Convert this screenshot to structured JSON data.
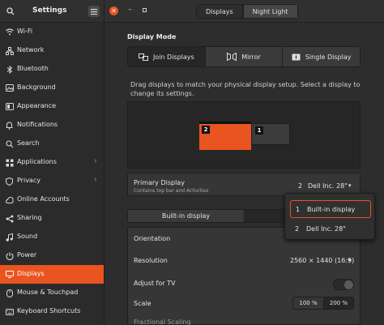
{
  "sidebar": {
    "title": "Settings",
    "items": [
      {
        "label": "Wi-Fi",
        "icon": "wifi-icon",
        "chevron": false
      },
      {
        "label": "Network",
        "icon": "network-icon",
        "chevron": false
      },
      {
        "label": "Bluetooth",
        "icon": "bluetooth-icon",
        "chevron": false
      },
      {
        "label": "Background",
        "icon": "background-icon",
        "chevron": false
      },
      {
        "label": "Appearance",
        "icon": "appearance-icon",
        "chevron": false
      },
      {
        "label": "Notifications",
        "icon": "bell-icon",
        "chevron": false
      },
      {
        "label": "Search",
        "icon": "search-icon",
        "chevron": false
      },
      {
        "label": "Applications",
        "icon": "applications-icon",
        "chevron": true
      },
      {
        "label": "Privacy",
        "icon": "privacy-icon",
        "chevron": true
      },
      {
        "label": "Online Accounts",
        "icon": "online-accounts-icon",
        "chevron": false
      },
      {
        "label": "Sharing",
        "icon": "sharing-icon",
        "chevron": false
      },
      {
        "label": "Sound",
        "icon": "sound-icon",
        "chevron": false
      },
      {
        "label": "Power",
        "icon": "power-icon",
        "chevron": false
      },
      {
        "label": "Displays",
        "icon": "display-icon",
        "chevron": false,
        "active": true
      },
      {
        "label": "Mouse & Touchpad",
        "icon": "mouse-icon",
        "chevron": false
      },
      {
        "label": "Keyboard Shortcuts",
        "icon": "keyboard-icon",
        "chevron": false
      }
    ]
  },
  "header": {
    "tabs": [
      {
        "label": "Displays",
        "active": false
      },
      {
        "label": "Night Light",
        "active": true
      }
    ]
  },
  "display_mode": {
    "title": "Display Mode",
    "options": [
      {
        "label": "Join Displays",
        "active": true
      },
      {
        "label": "Mirror",
        "active": false
      },
      {
        "label": "Single Display",
        "active": false
      }
    ]
  },
  "arrangement": {
    "hint": "Drag displays to match your physical display setup. Select a display to change its settings.",
    "display_1_number": "2",
    "display_2_number": "1"
  },
  "primary_display": {
    "label": "Primary Display",
    "sublabel": "Contains top bar and Activities",
    "value_num": "2",
    "value_name": "Dell Inc. 28\""
  },
  "display_tabs": {
    "first": "Built-in display",
    "second": ""
  },
  "settings": {
    "orientation_label": "Orientation",
    "resolution_label": "Resolution",
    "resolution_value": "2560 × 1440 (16:9)",
    "adjust_tv_label": "Adjust for TV",
    "scale_label": "Scale",
    "scale_options": [
      "100 %",
      "200 %"
    ],
    "scale_selected": "200 %",
    "fractional_label": "Fractional Scaling"
  },
  "dropdown": {
    "items": [
      {
        "num": "1",
        "label": "Built-in display",
        "selected": true
      },
      {
        "num": "2",
        "label": "Dell Inc. 28\"",
        "selected": false
      }
    ]
  },
  "colors": {
    "accent": "#e95420",
    "background": "#2d2d2d",
    "card": "#363636"
  }
}
